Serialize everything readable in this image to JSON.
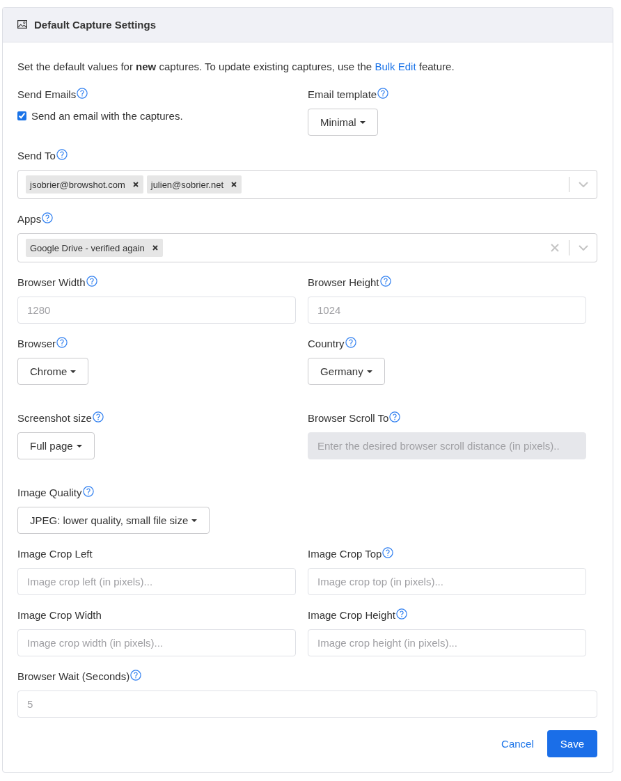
{
  "panel": {
    "title": "Default Capture Settings"
  },
  "intro": {
    "text": "Set the default values for **new** captures. To update existing captures, use the",
    "link": "Bulk Edit",
    "after": "feature."
  },
  "rows": [
    {
      "fields": [
        {
          "kind": "checkbox",
          "label": "Send Emails",
          "help": true,
          "checkbox": {
            "label": "Send an email with the captures.",
            "checked": true
          }
        },
        {
          "kind": "dropdown",
          "label": "Email template",
          "help": true,
          "value": "Minimal"
        }
      ]
    },
    {
      "fields": [
        {
          "kind": "tags",
          "label": "Send To",
          "help": true,
          "tags": [
            "jsobrier@browshot.com",
            "julien@sobrier.net"
          ],
          "clear_button": false
        }
      ]
    },
    {
      "fields": [
        {
          "kind": "tags",
          "label": "Apps",
          "help": true,
          "tags": [
            "Google Drive - verified again"
          ],
          "clear_button": true
        }
      ]
    },
    {
      "fields": [
        {
          "kind": "input",
          "label": "Browser Width",
          "help": true,
          "placeholder": "1280",
          "disabled": false
        },
        {
          "kind": "input",
          "label": "Browser Height",
          "help": true,
          "placeholder": "1024",
          "disabled": false
        }
      ]
    },
    {
      "fields": [
        {
          "kind": "dropdown",
          "label": "Browser",
          "help": true,
          "value": "Chrome"
        },
        {
          "kind": "dropdown",
          "label": "Country",
          "help": true,
          "value": "Germany"
        }
      ]
    },
    {
      "fields": [
        {
          "kind": "dropdown",
          "label": "Screenshot size",
          "help": true,
          "value": "Full page"
        },
        {
          "kind": "input",
          "label": "Browser Scroll To",
          "help": true,
          "placeholder": "Enter the desired browser scroll distance (in pixels)..",
          "disabled": true
        }
      ]
    },
    {
      "fields": [
        {
          "kind": "dropdown",
          "label": "Image Quality",
          "help": true,
          "value": "JPEG: lower quality, small file size"
        }
      ]
    },
    {
      "fields": [
        {
          "kind": "input",
          "label": "Image Crop Left",
          "help": false,
          "placeholder": "Image crop left (in pixels)...",
          "disabled": false
        },
        {
          "kind": "input",
          "label": "Image Crop Top",
          "help": true,
          "placeholder": "Image crop top (in pixels)...",
          "disabled": false
        }
      ]
    },
    {
      "fields": [
        {
          "kind": "input",
          "label": "Image Crop Width",
          "help": false,
          "placeholder": "Image crop width (in pixels)...",
          "disabled": false
        },
        {
          "kind": "input",
          "label": "Image Crop Height",
          "help": true,
          "placeholder": "Image crop height (in pixels)...",
          "disabled": false
        }
      ]
    },
    {
      "fields": [
        {
          "kind": "input",
          "label": "Browser Wait (Seconds)",
          "help": true,
          "placeholder": "5",
          "disabled": false
        }
      ]
    }
  ],
  "actions": [
    {
      "kind": "link",
      "label": "Cancel"
    },
    {
      "kind": "primary",
      "label": "Save"
    }
  ]
}
